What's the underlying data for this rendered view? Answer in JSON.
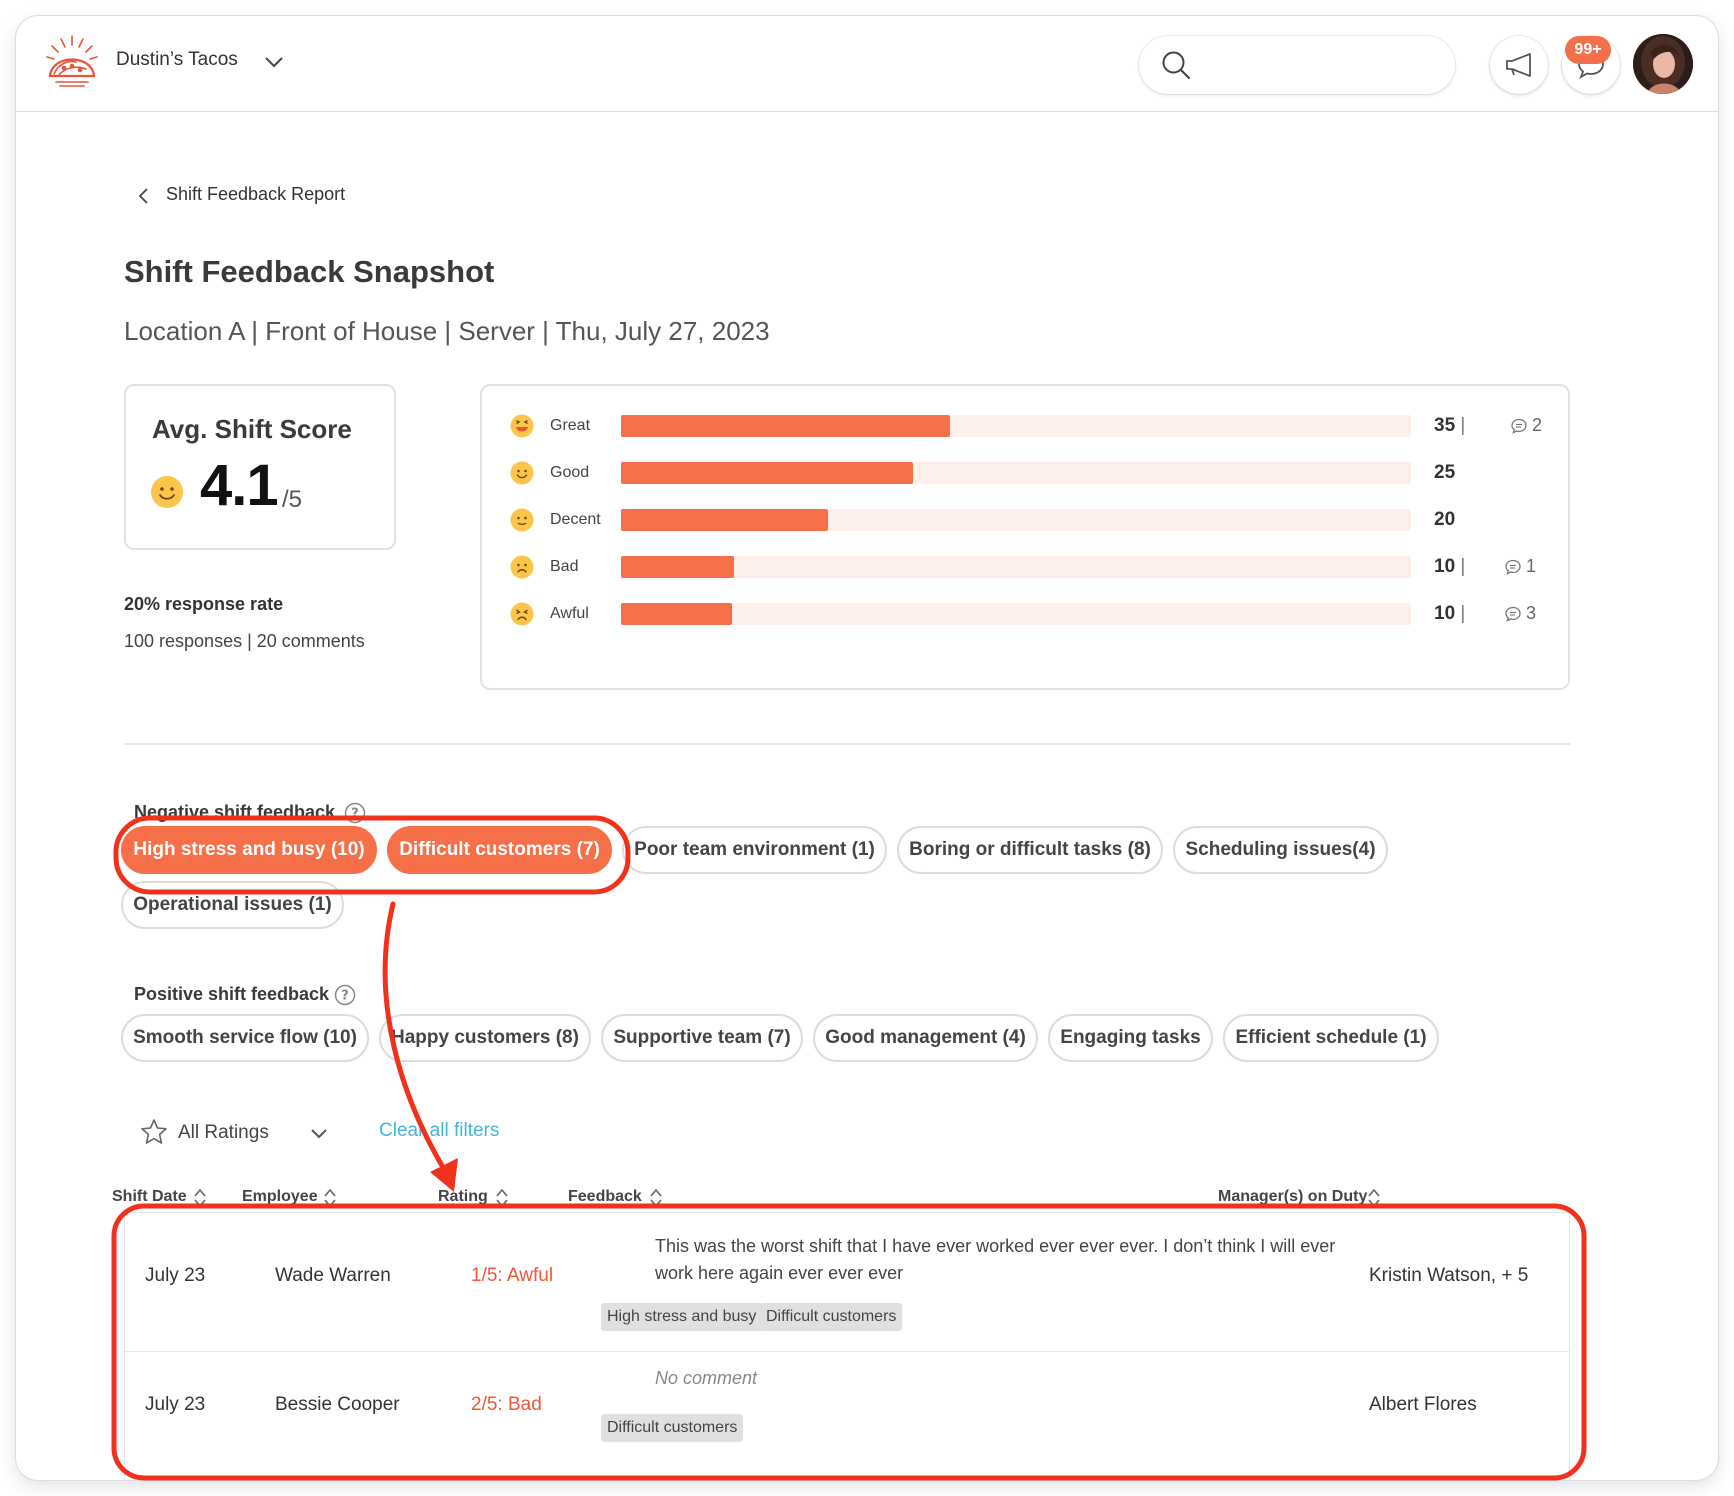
{
  "header": {
    "brand": "Dustin’s Tacos",
    "notifications_badge": "99+",
    "brand_color": "#f26f4c"
  },
  "breadcrumb": {
    "back_label": "Shift Feedback Report"
  },
  "page": {
    "title": "Shift Feedback Snapshot",
    "subtitle": "Location A | Front of House | Server | Thu, July 27, 2023"
  },
  "score": {
    "label": "Avg. Shift Score",
    "value": "4.1",
    "out_of": "/5",
    "response_rate": "20% response rate",
    "counts": "100 responses | 20 comments"
  },
  "distribution": {
    "max_value": 84,
    "bar_color": "#f56f49",
    "track_color": "#fdefe9",
    "rows": [
      {
        "label": "Great",
        "value": 35,
        "count_text": "35",
        "comments": "2",
        "icon": "grinning-face-icon"
      },
      {
        "label": "Good",
        "value": 31,
        "count_text": "25",
        "comments": "",
        "icon": "smiling-face-icon"
      },
      {
        "label": "Decent",
        "value": 22,
        "count_text": "20",
        "comments": "",
        "icon": "neutral-face-icon"
      },
      {
        "label": "Bad",
        "value": 12,
        "count_text": "10",
        "comments": "1",
        "icon": "frowning-face-icon"
      },
      {
        "label": "Awful",
        "value": 11.8,
        "count_text": "10",
        "comments": "3",
        "icon": "tired-face-icon"
      }
    ]
  },
  "negative": {
    "label": "Negative shift feedback",
    "chips": [
      {
        "label": "High stress and busy (10)",
        "active": true
      },
      {
        "label": "Difficult customers (7)",
        "active": true
      },
      {
        "label": "Poor team environment (1)",
        "active": false
      },
      {
        "label": "Boring or difficult tasks (8)",
        "active": false
      },
      {
        "label": "Scheduling issues(4)",
        "active": false
      },
      {
        "label": "Operational issues (1)",
        "active": false
      }
    ]
  },
  "positive": {
    "label": "Positive shift feedback",
    "chips": [
      {
        "label": "Smooth service flow (10)"
      },
      {
        "label": "Happy customers (8)"
      },
      {
        "label": "Supportive team (7)"
      },
      {
        "label": "Good management (4)"
      },
      {
        "label": "Engaging tasks"
      },
      {
        "label": "Efficient schedule (1)"
      }
    ]
  },
  "filters": {
    "ratings_label": "All Ratings",
    "clear_label": "Clear all filters"
  },
  "table": {
    "columns": [
      "Shift Date",
      "Employee",
      "Rating",
      "Feedback",
      "Manager(s) on Duty"
    ],
    "rows": [
      {
        "date": "July 23",
        "employee": "Wade Warren",
        "rating": "1/5: Awful",
        "feedback": "This was the worst shift that I have ever worked ever ever ever. I don’t think I will ever work here again ever ever ever",
        "tags": [
          "High stress and busy",
          "Difficult customers"
        ],
        "managers": "Kristin Watson, + 5"
      },
      {
        "date": "July 23",
        "employee": "Bessie Cooper",
        "rating": "2/5: Bad",
        "feedback": "No comment",
        "tags": [
          "Difficult customers"
        ],
        "managers": "Albert Flores"
      }
    ]
  },
  "annotation_color": "#f1311c"
}
